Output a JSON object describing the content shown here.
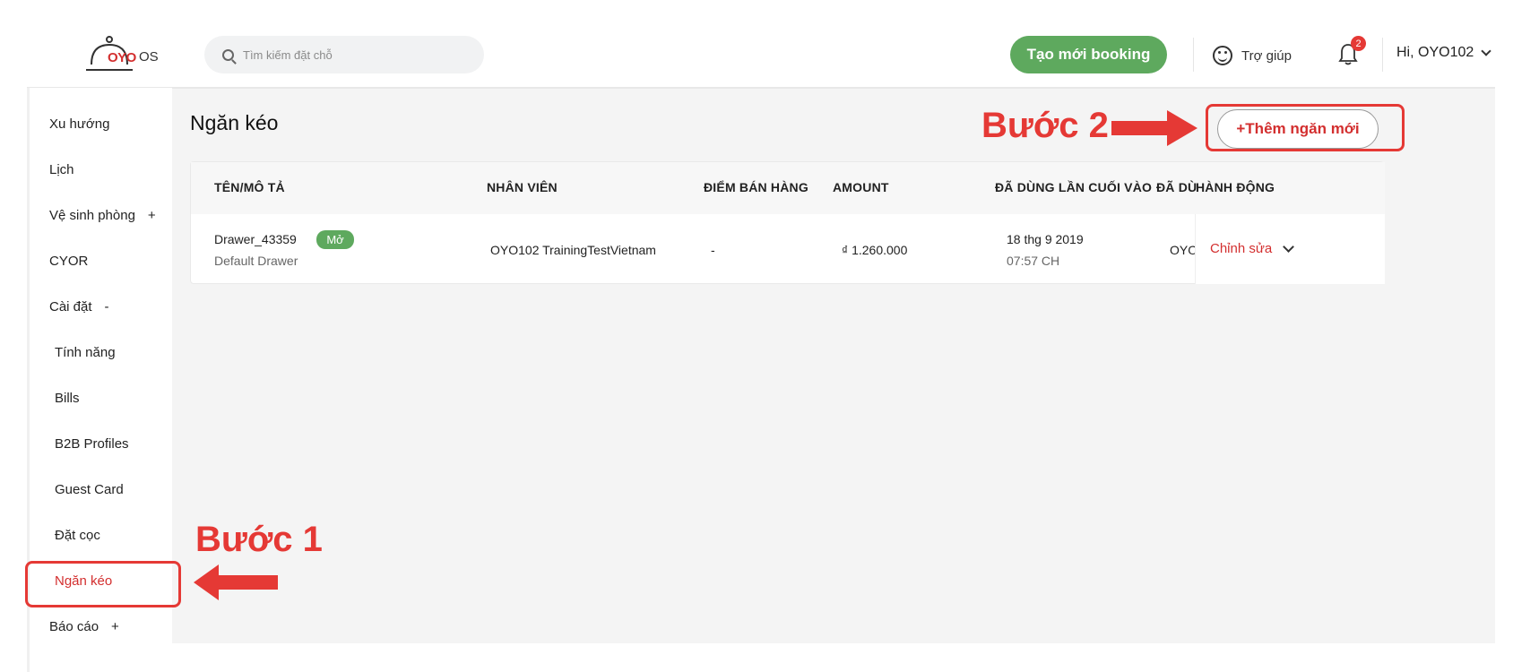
{
  "header": {
    "logo_text": "OYO",
    "logo_suffix": "OS",
    "search_placeholder": "Tìm kiếm đặt chỗ",
    "create_booking": "Tạo mới booking",
    "help": "Trợ giúp",
    "notifications_count": "2",
    "user_greeting": "Hi, OYO102"
  },
  "sidebar": {
    "items": [
      {
        "label": "Xu hướng"
      },
      {
        "label": "Lịch"
      },
      {
        "label": "Vệ sinh phòng",
        "toggle": "+"
      },
      {
        "label": "CYOR"
      },
      {
        "label": "Cài đặt",
        "toggle": "-"
      },
      {
        "label": "Tính năng"
      },
      {
        "label": "Bills"
      },
      {
        "label": "B2B Profiles"
      },
      {
        "label": "Guest Card"
      },
      {
        "label": "Đặt cọc"
      },
      {
        "label": "Ngăn kéo"
      },
      {
        "label": "Báo cáo",
        "toggle": "+"
      }
    ]
  },
  "main": {
    "title": "Ngăn kéo",
    "add_button": "+Thêm ngăn mới",
    "table": {
      "headers": [
        "TÊN/MÔ TẢ",
        "NHÂN VIÊN",
        "ĐIỂM BÁN HÀNG",
        "AMOUNT",
        "ĐÃ DÙNG LẦN CUỐI VÀO",
        "ĐÃ DÙ",
        "HÀNH ĐỘNG"
      ],
      "row": {
        "name": "Drawer_43359",
        "status": "Mở",
        "description": "Default Drawer",
        "employee": "OYO102 TrainingTestVietnam",
        "pos": "-",
        "amount": "₫ 1.260.000",
        "last_used_date": "18 thg 9 2019",
        "last_used_time": "07:57 CH",
        "used_by": "OYO",
        "action": "Chỉnh sửa"
      }
    }
  },
  "annotations": {
    "step1": "Bước 1",
    "step2": "Bước 2",
    "color": "#e53935"
  },
  "colors": {
    "brand_red": "#d32f2f",
    "green": "#5ea95e"
  }
}
